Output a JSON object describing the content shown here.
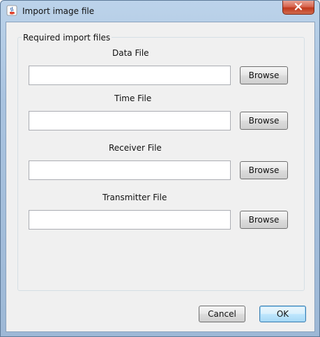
{
  "window": {
    "title": "Import image file",
    "app_icon": "java-cup-icon",
    "close_icon": "close-icon"
  },
  "group": {
    "title": "Required import files"
  },
  "fields": [
    {
      "label": "Data File",
      "value": "",
      "browse_label": "Browse"
    },
    {
      "label": "Time File",
      "value": "",
      "browse_label": "Browse"
    },
    {
      "label": "Receiver File",
      "value": "",
      "browse_label": "Browse"
    },
    {
      "label": "Transmitter File",
      "value": "",
      "browse_label": "Browse"
    }
  ],
  "footer": {
    "cancel_label": "Cancel",
    "ok_label": "OK"
  },
  "colors": {
    "titlebar": "#a9c3df",
    "close_button": "#c0391c",
    "client_background": "#f0f0f0",
    "default_button_border": "#3c7fb1"
  }
}
